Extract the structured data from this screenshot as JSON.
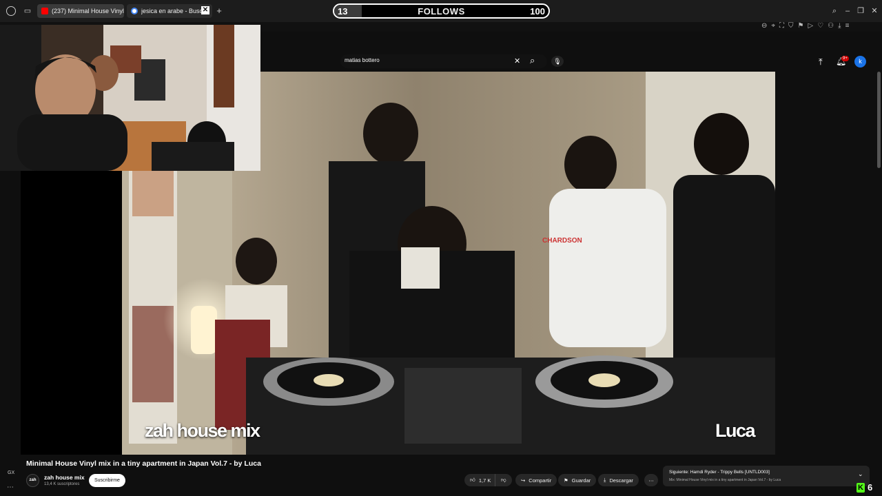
{
  "browser": {
    "tabs": [
      {
        "label": "(237) Minimal House Vinyl"
      },
      {
        "label": "jesica en arabe - Busca"
      }
    ]
  },
  "overlay": {
    "follows_current": "13",
    "follows_label": "FOLLOWS",
    "follows_goal": "100",
    "follows_progress": 0.13,
    "corner_count": "6"
  },
  "search": {
    "query": "matias bottero"
  },
  "notifications": {
    "badge": "9+"
  },
  "account": {
    "initial": "k"
  },
  "video": {
    "overlay_left": "zah house mix",
    "overlay_right": "Luca",
    "shirt_text": "CHARDSON",
    "title": "Minimal House Vinyl mix in a tiny apartment in Japan Vol.7 - by Luca"
  },
  "channel": {
    "avatar_text": "zah",
    "name": "zah house mix",
    "subscribers": "13,4 K suscriptores",
    "subscribe": "Suscribirme"
  },
  "actions": {
    "likes": "1,7 K",
    "share": "Compartir",
    "save": "Guardar",
    "download": "Descargar"
  },
  "next": {
    "title": "Siguiente: Hamdi Ryder - Trippy Bells [UNTLD003]",
    "subtitle": "Mix: Minimal House Vinyl mix in a tiny apartment in Japan Vol.7 - by Luca"
  },
  "sidebar": {
    "gx": "GX"
  },
  "colors": {
    "yt_red": "#ff0000",
    "kick_green": "#53fc18",
    "bg": "#0f0f0f",
    "account_blue": "#1a73e8"
  }
}
